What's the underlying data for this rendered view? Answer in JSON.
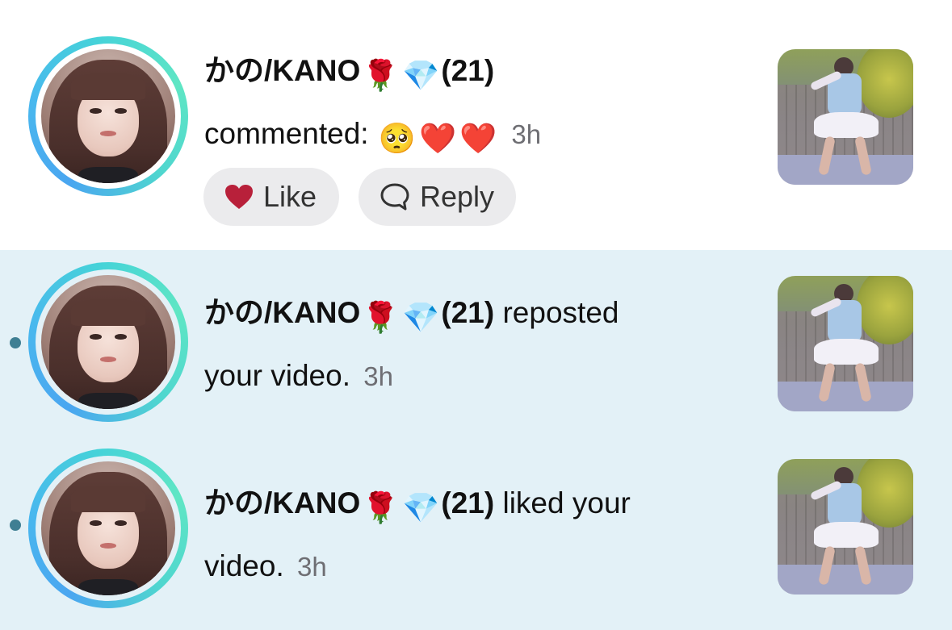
{
  "notifications": [
    {
      "username": "かの/KANO",
      "rank": "(21)",
      "action_text": "commented:",
      "comment_emojis": [
        "🥺",
        "❤️",
        "❤️"
      ],
      "time": "3h",
      "unread": false,
      "like_label": "Like",
      "reply_label": "Reply"
    },
    {
      "username": "かの/KANO",
      "rank": "(21)",
      "action_text_1": "reposted",
      "action_text_2": "your video.",
      "time": "3h",
      "unread": true
    },
    {
      "username": "かの/KANO",
      "rank": "(21)",
      "action_text_1": "liked your",
      "action_text_2": "video.",
      "time": "3h",
      "unread": true
    }
  ],
  "name_emojis": [
    "🌹",
    "💎"
  ],
  "colors": {
    "unread_background": "#e3f1f7",
    "unread_dot": "#3f7f93",
    "like_heart": "#b8203a",
    "pill_background": "#ebebed"
  },
  "icons": {
    "like": "heart-icon",
    "reply": "speech-bubble-icon"
  }
}
